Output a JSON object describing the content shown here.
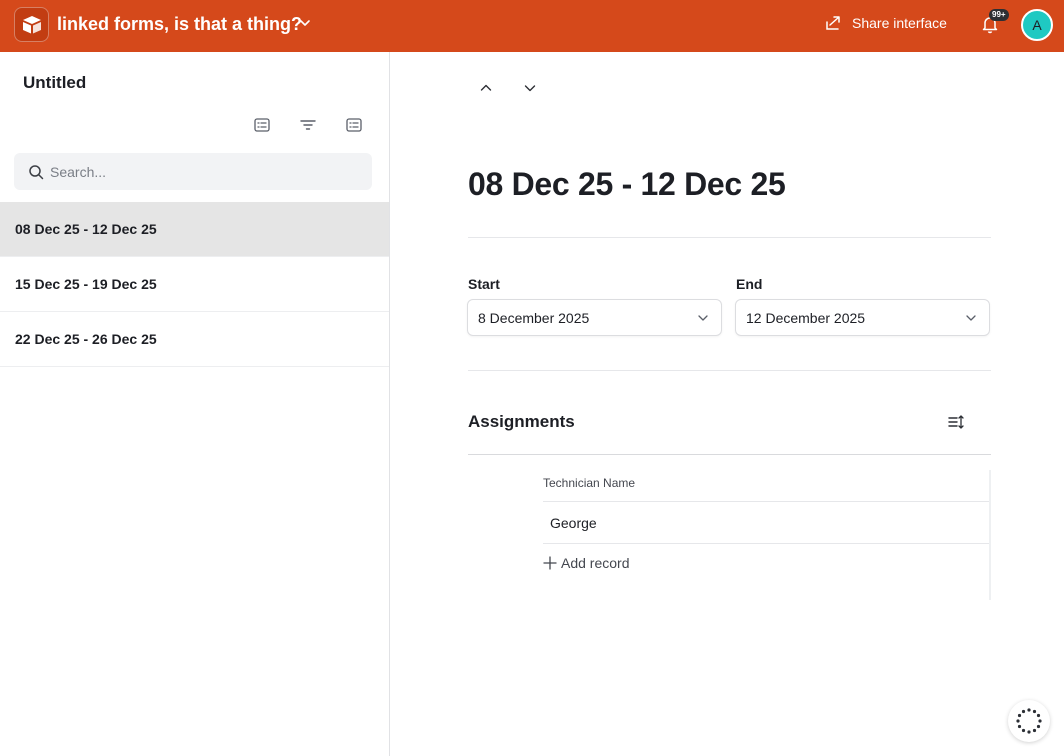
{
  "header": {
    "title": "linked forms, is that a thing?",
    "share_label": "Share interface",
    "notification_badge": "99+",
    "avatar_initial": "A",
    "accent_color": "#d5491b"
  },
  "sidebar": {
    "title": "Untitled",
    "search_placeholder": "Search...",
    "items": [
      {
        "label": "08 Dec 25 - 12 Dec 25",
        "selected": true
      },
      {
        "label": "15 Dec 25 - 19 Dec 25",
        "selected": false
      },
      {
        "label": "22 Dec 25 - 26 Dec 25",
        "selected": false
      }
    ]
  },
  "record": {
    "title": "08 Dec 25 - 12 Dec 25",
    "start_label": "Start",
    "start_value": "8 December 2025",
    "end_label": "End",
    "end_value": "12 December 2025"
  },
  "assignments": {
    "title": "Assignments",
    "column_header": "Technician Name",
    "rows": [
      "George"
    ],
    "add_record_label": "Add record"
  }
}
